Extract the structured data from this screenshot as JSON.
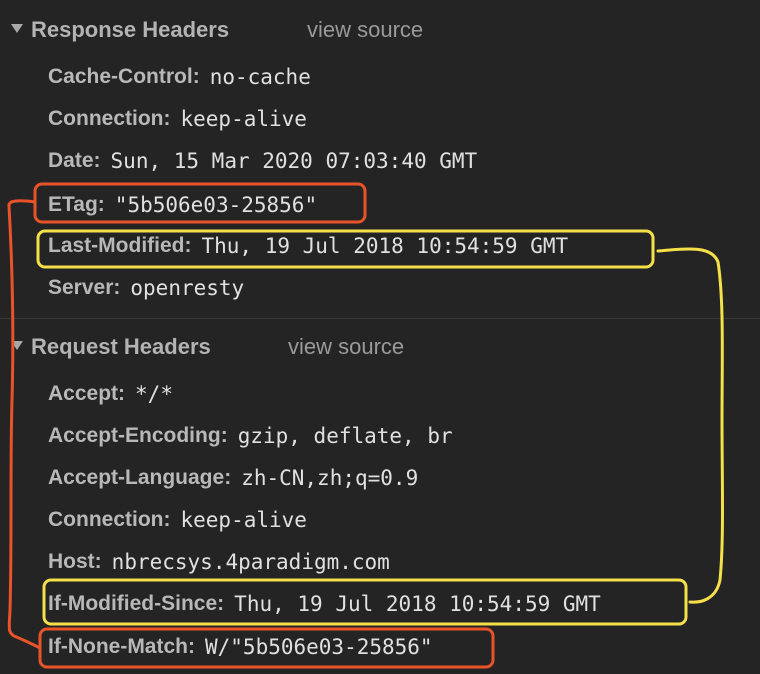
{
  "response": {
    "title": "Response Headers",
    "view_source": "view source",
    "headers": [
      {
        "name": "Cache-Control",
        "value": "no-cache"
      },
      {
        "name": "Connection",
        "value": "keep-alive"
      },
      {
        "name": "Date",
        "value": "Sun, 15 Mar 2020 07:03:40 GMT"
      },
      {
        "name": "ETag",
        "value": "\"5b506e03-25856\""
      },
      {
        "name": "Last-Modified",
        "value": "Thu, 19 Jul 2018 10:54:59 GMT"
      },
      {
        "name": "Server",
        "value": "openresty"
      }
    ]
  },
  "request": {
    "title": "Request Headers",
    "view_source": "view source",
    "headers": [
      {
        "name": "Accept",
        "value": "*/*"
      },
      {
        "name": "Accept-Encoding",
        "value": "gzip, deflate, br"
      },
      {
        "name": "Accept-Language",
        "value": "zh-CN,zh;q=0.9"
      },
      {
        "name": "Connection",
        "value": "keep-alive"
      },
      {
        "name": "Host",
        "value": "nbrecsys.4paradigm.com"
      },
      {
        "name": "If-Modified-Since",
        "value": "Thu, 19 Jul 2018 10:54:59 GMT"
      },
      {
        "name": "If-None-Match",
        "value": "W/\"5b506e03-25856\""
      }
    ]
  },
  "annotation_colors": {
    "etag_pair": "#e8532a",
    "modified_pair": "#f5e04a"
  }
}
